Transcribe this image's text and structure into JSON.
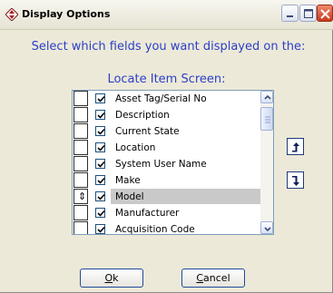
{
  "window": {
    "title": "Display Options"
  },
  "prompt": {
    "line1": "Select which fields you want displayed on the:",
    "line2": "Locate Item Screen:"
  },
  "fields": [
    {
      "label": "Asset Tag/Serial No",
      "checked": true,
      "selected": false
    },
    {
      "label": "Description",
      "checked": true,
      "selected": false
    },
    {
      "label": "Current State",
      "checked": true,
      "selected": false
    },
    {
      "label": "Location",
      "checked": true,
      "selected": false
    },
    {
      "label": "System User Name",
      "checked": true,
      "selected": false
    },
    {
      "label": "Make",
      "checked": true,
      "selected": false
    },
    {
      "label": "Model",
      "checked": true,
      "selected": true
    },
    {
      "label": "Manufacturer",
      "checked": true,
      "selected": false
    },
    {
      "label": "Acquisition Code",
      "checked": true,
      "selected": false
    }
  ],
  "buttons": {
    "ok_mnemonic": "O",
    "ok_rest": "k",
    "cancel_mnemonic": "C",
    "cancel_rest": "ancel"
  },
  "icons": {
    "app": "diamond-arrows-icon",
    "minimize": "minimize-icon",
    "maximize": "maximize-icon",
    "close": "close-icon",
    "move_up": "move-up-icon",
    "move_down": "move-down-icon",
    "selected_row_marker": "up-down-arrows-icon"
  },
  "colors": {
    "prompt_text": "#2b3fc9",
    "close_button": "#c9391d",
    "selection": "#c9c9c9"
  }
}
